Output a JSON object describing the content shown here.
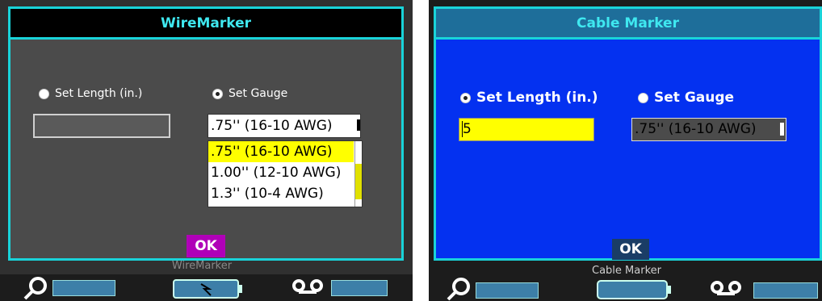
{
  "left": {
    "title": "WireMarker",
    "radio_length": "Set Length (in.)",
    "radio_gauge": "Set Gauge",
    "length_value": "",
    "gauge_value": ".75'' (16-10 AWG)",
    "options": [
      ".75'' (16-10 AWG)",
      "1.00'' (12-10 AWG)",
      "1.3'' (10-4 AWG)"
    ],
    "ok_label": "OK",
    "caption": "WireMarker"
  },
  "right": {
    "title": "Cable Marker",
    "radio_length": "Set Length (in.)",
    "radio_gauge": "Set Gauge",
    "length_value": "5",
    "gauge_value": ".75'' (16-10 AWG)",
    "ok_label": "OK",
    "caption": "Cable Marker"
  },
  "colors": {
    "accent": "#19d3d9",
    "left_bg": "#4b4b4b",
    "right_bg": "#0431f0",
    "highlight": "#ffff00",
    "ok_left": "#b000b8",
    "ok_right": "#1a3d66"
  },
  "icons": [
    "search-icon",
    "battery-icon",
    "cassette-icon"
  ]
}
